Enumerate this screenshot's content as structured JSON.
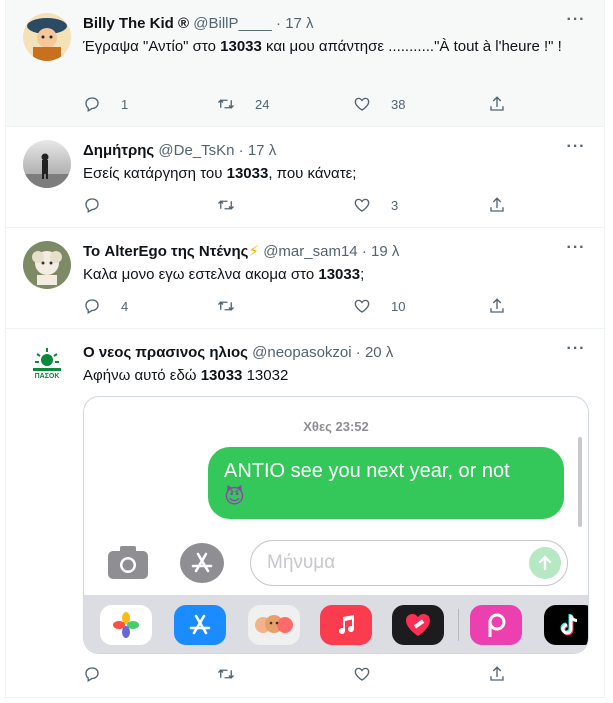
{
  "tweets": [
    {
      "name": "Billy The Kid",
      "badge": "®",
      "handle": "@BillP____",
      "time": "17 λ",
      "text_before": "Έγραψα \"Αντίο\" στο ",
      "text_bold": "13033",
      "text_after": " και μου απάντησε ...........\"À tout à l'heure !\" !",
      "replies": "1",
      "retweets": "24",
      "likes": "38"
    },
    {
      "name": "Δημήτρης",
      "handle": "@De_TsKn",
      "time": "17 λ",
      "text_before": "Εσείς κατάργηση του ",
      "text_bold": "13033",
      "text_after": ", που κάνατε;",
      "replies": "",
      "retweets": "",
      "likes": "3"
    },
    {
      "name": "Το AlterEgo της Ντένης",
      "emoji": "⚡",
      "handle": "@mar_sam14",
      "time": "19 λ",
      "text_before": "Καλα μονο εγω εστελνα ακομα στο ",
      "text_bold": "13033",
      "text_after": ";",
      "replies": "4",
      "retweets": "",
      "likes": "10"
    },
    {
      "name": "Ο νεος πρασινος ηλιος",
      "handle": "@neopasokzoi",
      "time": "20 λ",
      "avatar_text": "ΠΑΣΟΚ",
      "text_before": "Αφήνω αυτό εδώ ",
      "text_bold": "13033",
      "text_after": " 13032",
      "replies": "",
      "retweets": "",
      "likes": "",
      "media": {
        "timestamp": "Χθες 23:52",
        "bubble_text": "ΑΝΤΙΟ see you next year, or not",
        "bubble_emoji": "😈",
        "input_placeholder": "Μήνυμα"
      }
    }
  ],
  "separator_dot": "·",
  "icons": [
    "reply-icon",
    "retweet-icon",
    "like-icon",
    "share-icon",
    "more-icon"
  ],
  "colors": {
    "muted": "#536471",
    "imessage_green": "#34c759",
    "pasok_green": "#0a8a3a"
  }
}
